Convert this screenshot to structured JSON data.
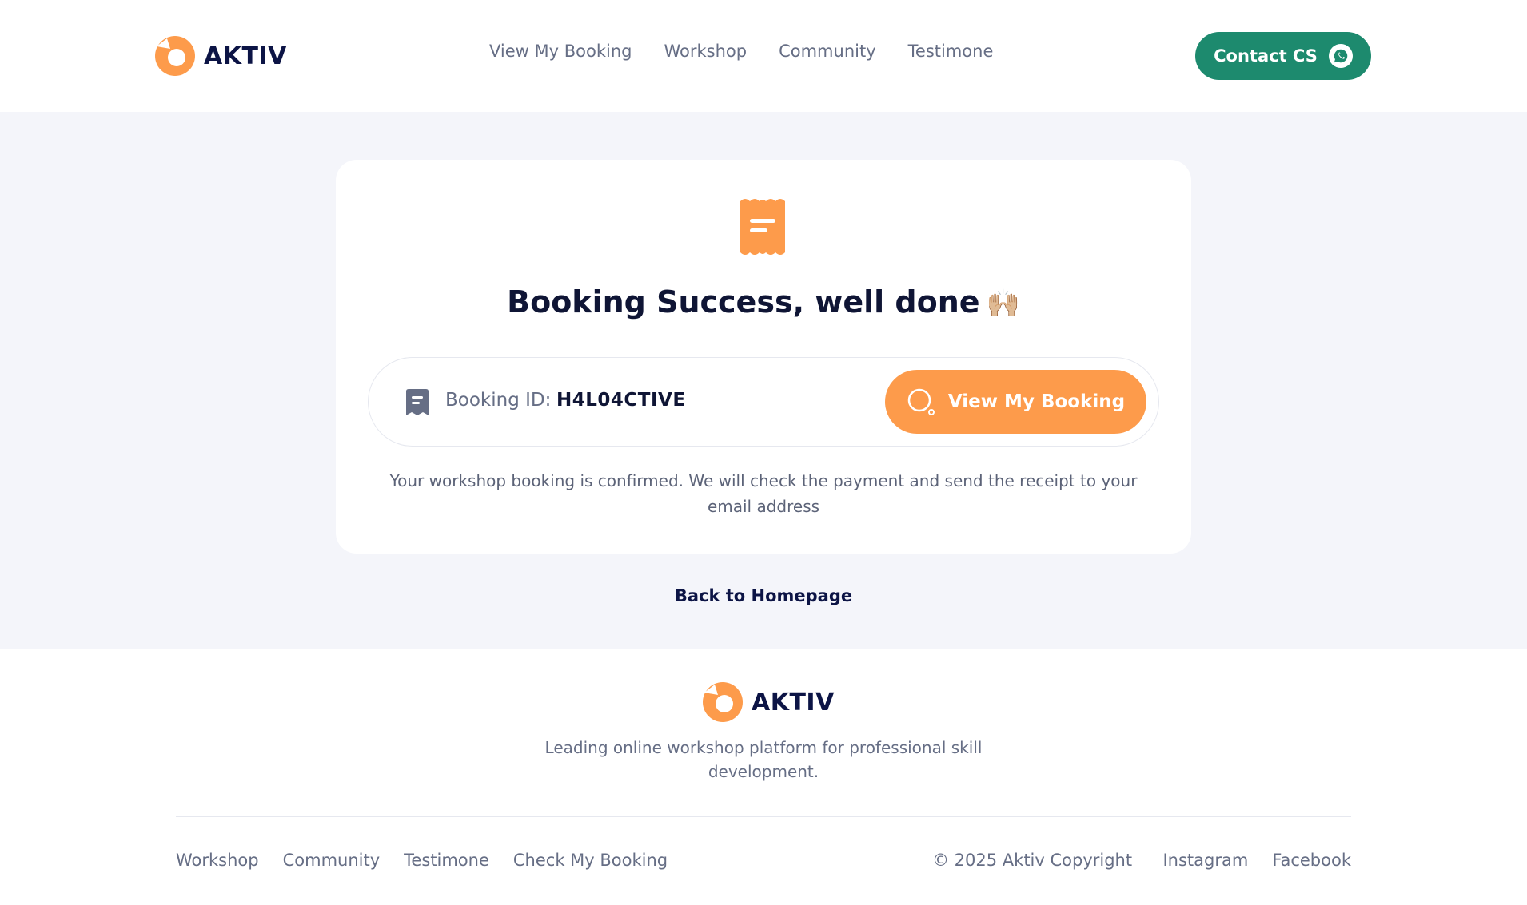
{
  "header": {
    "brand_name": "AKTIV",
    "nav": [
      {
        "label": "View My Booking"
      },
      {
        "label": "Workshop"
      },
      {
        "label": "Community"
      },
      {
        "label": "Testimone"
      }
    ],
    "contact_label": "Contact CS"
  },
  "card": {
    "title": "Booking Success, well done",
    "title_emoji": "🙌🏼",
    "booking_label": "Booking ID:",
    "booking_id": "H4L04CTIVE",
    "view_button_label": "View My Booking",
    "description": "Your workshop booking is confirmed. We will check the payment and send the receipt to your email address"
  },
  "back_link": "Back to Homepage",
  "footer": {
    "brand_name": "AKTIV",
    "tagline": "Leading online workshop platform for professional skill development.",
    "nav": [
      {
        "label": "Workshop"
      },
      {
        "label": "Community"
      },
      {
        "label": "Testimone"
      },
      {
        "label": "Check My Booking"
      }
    ],
    "copyright": "© 2025 Aktiv Copyright",
    "social": [
      {
        "label": "Instagram"
      },
      {
        "label": "Facebook"
      }
    ]
  },
  "colors": {
    "brand_orange": "#fd9b4b",
    "brand_navy": "#0c1445",
    "contact_green": "#1d8a6e",
    "page_background": "#f4f5fa"
  },
  "icons": {
    "logo": "aktiv-logo-icon",
    "contact": "whatsapp-icon",
    "receipt": "receipt-icon",
    "booking": "booking-receipt-icon",
    "view": "search-icon"
  }
}
